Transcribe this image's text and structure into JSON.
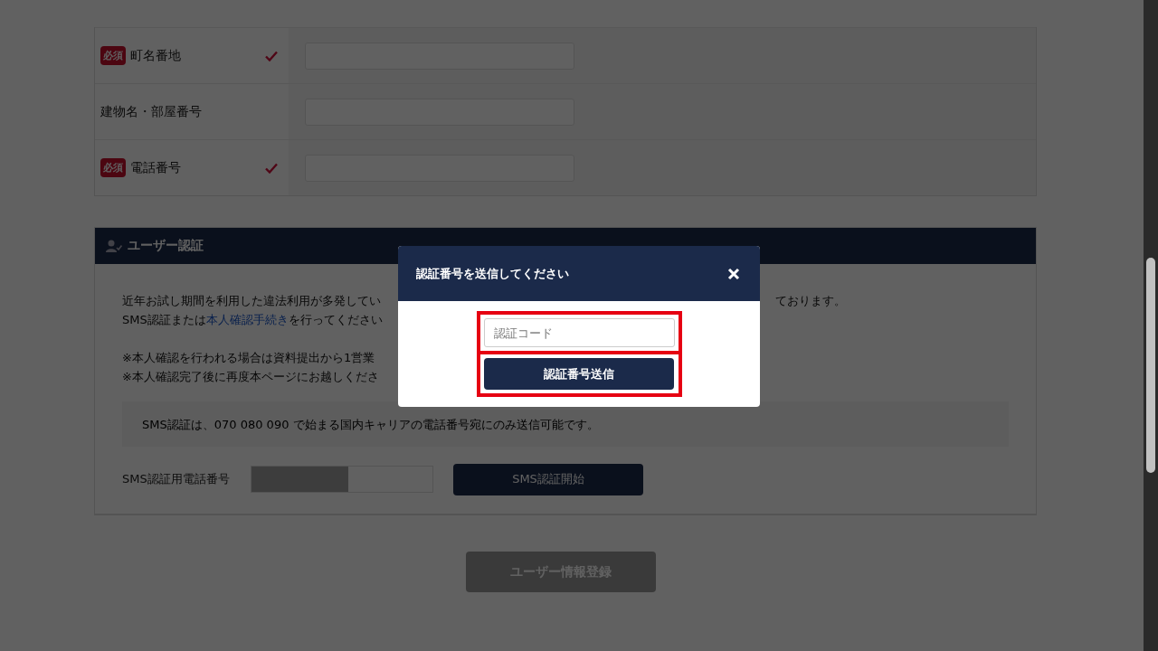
{
  "form_rows": [
    {
      "label": "町名番地",
      "required": true,
      "badge": "必須",
      "valid": true
    },
    {
      "label": "建物名・部屋番号",
      "required": false,
      "valid": false
    },
    {
      "label": "電話番号",
      "required": true,
      "badge": "必須",
      "valid": true
    }
  ],
  "user_auth": {
    "title": "ユーザー認証",
    "paragraphs": [
      [
        {
          "segments": [
            {
              "kind": "text",
              "text": "近年お試し期間を利用した違法利用が多発してい"
            }
          ],
          "right": "ております。"
        },
        {
          "segments": [
            {
              "kind": "text",
              "text": "SMS認証または"
            },
            {
              "kind": "link",
              "text": "本人確認手続き"
            },
            {
              "kind": "text",
              "text": "を行ってください"
            }
          ]
        }
      ],
      [
        {
          "segments": [
            {
              "kind": "text",
              "text": "※本人確認を行われる場合は資料提出から1営業"
            }
          ]
        },
        {
          "segments": [
            {
              "kind": "text",
              "text": "※本人確認完了後に再度本ページにお越しくださ"
            }
          ]
        }
      ]
    ],
    "notice": "SMS認証は、070 080 090 で始まる国内キャリアの電話番号宛にのみ送信可能です。",
    "sms_label": "SMS認証用電話番号",
    "sms_button": "SMS認証開始"
  },
  "register_button": {
    "label": "ユーザー情報登録",
    "disabled": true
  },
  "modal": {
    "title": "認証番号を送信してください",
    "placeholder": "認証コード",
    "button": "認証番号送信"
  }
}
